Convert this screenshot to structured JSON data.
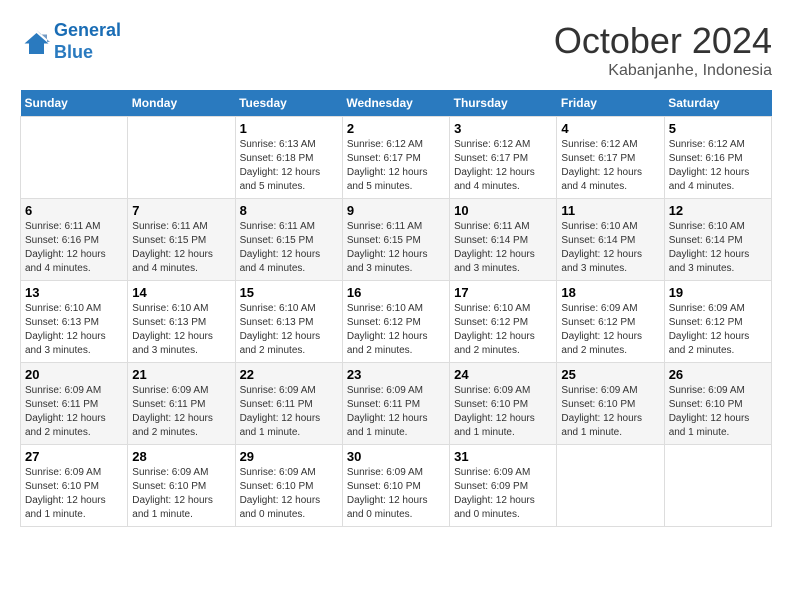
{
  "logo": {
    "line1": "General",
    "line2": "Blue"
  },
  "title": "October 2024",
  "subtitle": "Kabanjanhe, Indonesia",
  "days_header": [
    "Sunday",
    "Monday",
    "Tuesday",
    "Wednesday",
    "Thursday",
    "Friday",
    "Saturday"
  ],
  "weeks": [
    [
      {
        "day": "",
        "info": ""
      },
      {
        "day": "",
        "info": ""
      },
      {
        "day": "1",
        "info": "Sunrise: 6:13 AM\nSunset: 6:18 PM\nDaylight: 12 hours\nand 5 minutes."
      },
      {
        "day": "2",
        "info": "Sunrise: 6:12 AM\nSunset: 6:17 PM\nDaylight: 12 hours\nand 5 minutes."
      },
      {
        "day": "3",
        "info": "Sunrise: 6:12 AM\nSunset: 6:17 PM\nDaylight: 12 hours\nand 4 minutes."
      },
      {
        "day": "4",
        "info": "Sunrise: 6:12 AM\nSunset: 6:17 PM\nDaylight: 12 hours\nand 4 minutes."
      },
      {
        "day": "5",
        "info": "Sunrise: 6:12 AM\nSunset: 6:16 PM\nDaylight: 12 hours\nand 4 minutes."
      }
    ],
    [
      {
        "day": "6",
        "info": "Sunrise: 6:11 AM\nSunset: 6:16 PM\nDaylight: 12 hours\nand 4 minutes."
      },
      {
        "day": "7",
        "info": "Sunrise: 6:11 AM\nSunset: 6:15 PM\nDaylight: 12 hours\nand 4 minutes."
      },
      {
        "day": "8",
        "info": "Sunrise: 6:11 AM\nSunset: 6:15 PM\nDaylight: 12 hours\nand 4 minutes."
      },
      {
        "day": "9",
        "info": "Sunrise: 6:11 AM\nSunset: 6:15 PM\nDaylight: 12 hours\nand 3 minutes."
      },
      {
        "day": "10",
        "info": "Sunrise: 6:11 AM\nSunset: 6:14 PM\nDaylight: 12 hours\nand 3 minutes."
      },
      {
        "day": "11",
        "info": "Sunrise: 6:10 AM\nSunset: 6:14 PM\nDaylight: 12 hours\nand 3 minutes."
      },
      {
        "day": "12",
        "info": "Sunrise: 6:10 AM\nSunset: 6:14 PM\nDaylight: 12 hours\nand 3 minutes."
      }
    ],
    [
      {
        "day": "13",
        "info": "Sunrise: 6:10 AM\nSunset: 6:13 PM\nDaylight: 12 hours\nand 3 minutes."
      },
      {
        "day": "14",
        "info": "Sunrise: 6:10 AM\nSunset: 6:13 PM\nDaylight: 12 hours\nand 3 minutes."
      },
      {
        "day": "15",
        "info": "Sunrise: 6:10 AM\nSunset: 6:13 PM\nDaylight: 12 hours\nand 2 minutes."
      },
      {
        "day": "16",
        "info": "Sunrise: 6:10 AM\nSunset: 6:12 PM\nDaylight: 12 hours\nand 2 minutes."
      },
      {
        "day": "17",
        "info": "Sunrise: 6:10 AM\nSunset: 6:12 PM\nDaylight: 12 hours\nand 2 minutes."
      },
      {
        "day": "18",
        "info": "Sunrise: 6:09 AM\nSunset: 6:12 PM\nDaylight: 12 hours\nand 2 minutes."
      },
      {
        "day": "19",
        "info": "Sunrise: 6:09 AM\nSunset: 6:12 PM\nDaylight: 12 hours\nand 2 minutes."
      }
    ],
    [
      {
        "day": "20",
        "info": "Sunrise: 6:09 AM\nSunset: 6:11 PM\nDaylight: 12 hours\nand 2 minutes."
      },
      {
        "day": "21",
        "info": "Sunrise: 6:09 AM\nSunset: 6:11 PM\nDaylight: 12 hours\nand 2 minutes."
      },
      {
        "day": "22",
        "info": "Sunrise: 6:09 AM\nSunset: 6:11 PM\nDaylight: 12 hours\nand 1 minute."
      },
      {
        "day": "23",
        "info": "Sunrise: 6:09 AM\nSunset: 6:11 PM\nDaylight: 12 hours\nand 1 minute."
      },
      {
        "day": "24",
        "info": "Sunrise: 6:09 AM\nSunset: 6:10 PM\nDaylight: 12 hours\nand 1 minute."
      },
      {
        "day": "25",
        "info": "Sunrise: 6:09 AM\nSunset: 6:10 PM\nDaylight: 12 hours\nand 1 minute."
      },
      {
        "day": "26",
        "info": "Sunrise: 6:09 AM\nSunset: 6:10 PM\nDaylight: 12 hours\nand 1 minute."
      }
    ],
    [
      {
        "day": "27",
        "info": "Sunrise: 6:09 AM\nSunset: 6:10 PM\nDaylight: 12 hours\nand 1 minute."
      },
      {
        "day": "28",
        "info": "Sunrise: 6:09 AM\nSunset: 6:10 PM\nDaylight: 12 hours\nand 1 minute."
      },
      {
        "day": "29",
        "info": "Sunrise: 6:09 AM\nSunset: 6:10 PM\nDaylight: 12 hours\nand 0 minutes."
      },
      {
        "day": "30",
        "info": "Sunrise: 6:09 AM\nSunset: 6:10 PM\nDaylight: 12 hours\nand 0 minutes."
      },
      {
        "day": "31",
        "info": "Sunrise: 6:09 AM\nSunset: 6:09 PM\nDaylight: 12 hours\nand 0 minutes."
      },
      {
        "day": "",
        "info": ""
      },
      {
        "day": "",
        "info": ""
      }
    ]
  ]
}
